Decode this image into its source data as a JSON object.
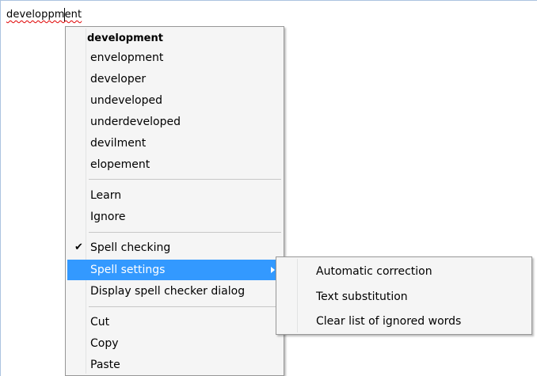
{
  "editor": {
    "text": "developpment"
  },
  "context_menu": {
    "suggestions_header": "development",
    "suggestions": [
      "envelopment",
      "developer",
      "undeveloped",
      "underdeveloped",
      "devilment",
      "elopement"
    ],
    "learn_label": "Learn",
    "ignore_label": "Ignore",
    "spell_checking_label": "Spell checking",
    "spell_checking_checked": true,
    "spell_settings_label": "Spell settings",
    "display_dialog_label": "Display spell checker dialog",
    "cut_label": "Cut",
    "copy_label": "Copy",
    "paste_label": "Paste"
  },
  "submenu": {
    "items": [
      "Automatic correction",
      "Text substitution",
      "Clear list of ignored words"
    ]
  },
  "colors": {
    "highlight": "#3399ff",
    "menu_background": "#f5f5f5",
    "misspell_underline": "#e00000"
  },
  "icons": {
    "check": "check-icon",
    "submenu_arrow": "chevron-right-icon"
  }
}
